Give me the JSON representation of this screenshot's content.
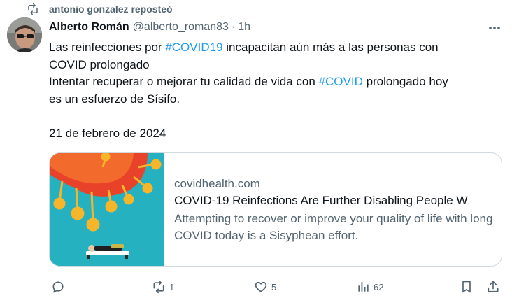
{
  "repost": {
    "text": "antonio gonzalez reposteó",
    "icon": "repost-icon"
  },
  "author": {
    "name": "Alberto Román",
    "handle": "@alberto_roman83",
    "separator": "·",
    "time": "1h"
  },
  "tweet": {
    "lines": [
      [
        {
          "t": "Las reinfecciones por "
        },
        {
          "t": "#COVID19",
          "tag": true
        },
        {
          "t": " incapacitan aún más a las personas con"
        }
      ],
      [
        {
          "t": "COVID prolongado"
        }
      ],
      [
        {
          "t": "Intentar recuperar o mejorar tu calidad de vida con "
        },
        {
          "t": "#COVID",
          "tag": true
        },
        {
          "t": " prolongado hoy"
        }
      ],
      [
        {
          "t": "es un esfuerzo de Sísifo."
        }
      ]
    ],
    "date": "21 de febrero de 2024"
  },
  "card": {
    "domain": "covidhealth.com",
    "title": "COVID-19 Reinfections Are Further Disabling People W",
    "description": "Attempting to recover or improve your quality of life with long COVID today is a Sisyphean effort."
  },
  "actions": {
    "reply": {
      "icon": "reply-icon",
      "count": ""
    },
    "repost": {
      "icon": "repost-icon",
      "count": "1"
    },
    "like": {
      "icon": "heart-icon",
      "count": "5"
    },
    "views": {
      "icon": "analytics-icon",
      "count": "62"
    },
    "bookmark": {
      "icon": "bookmark-icon"
    },
    "share": {
      "icon": "share-icon"
    }
  },
  "colors": {
    "accent": "#1d9bf0",
    "secondary_text": "#536471",
    "primary_text": "#0f1419",
    "border": "#cfd9de"
  }
}
